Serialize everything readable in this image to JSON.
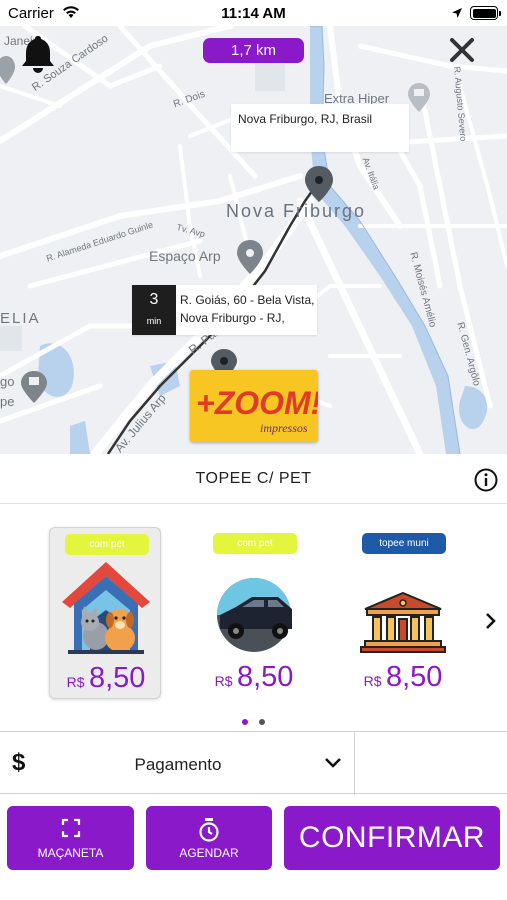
{
  "status_bar": {
    "carrier": "Carrier",
    "time": "11:14 AM"
  },
  "map": {
    "distance": "1,7 km",
    "destination_address": "Nova Friburgo, RJ, Brasil",
    "origin_eta_value": "3",
    "origin_eta_unit": "min",
    "origin_address_line1": "R. Goiás, 60 - Bela Vista,",
    "origin_address_line2": "Nova Friburgo - RJ,",
    "labels": {
      "city": "Nova Friburgo",
      "poi_arp": "Espaço Arp",
      "poi_extra": "Extra Hiper",
      "street_souza": "R. Souza Cardoso",
      "street_dois": "R. Dois",
      "street_alameda": "R. Alameda Eduardo Guinle",
      "street_avp": "Tv. Avp",
      "street_pastor": "R. Pastor",
      "street_julius": "Av. Julius Arp",
      "street_italia": "Av. Itália",
      "street_augusto": "R. Augusto Severo",
      "street_moises": "R. Moisés Amélio",
      "street_gen": "R. Gen. Argôlo",
      "edge_janeiro": "Janeiro",
      "edge_lia": "ELIA",
      "edge_go": "go",
      "edge_pe": "pe"
    },
    "colors": {
      "accent": "#8a19c9",
      "water": "#b8d1ec",
      "road": "#ffffff",
      "route": "#333333"
    }
  },
  "service": {
    "title": "TOPEE C/ PET"
  },
  "options": [
    {
      "tag": "com pet",
      "tag_color": "yellow",
      "currency": "R$",
      "price": "8,50",
      "icon": "pets-house-icon",
      "selected": true
    },
    {
      "tag": "com pet",
      "tag_color": "yellow",
      "currency": "R$",
      "price": "8,50",
      "icon": "car-icon",
      "selected": false
    },
    {
      "tag": "topee muni",
      "tag_color": "blue",
      "currency": "R$",
      "price": "8,50",
      "icon": "municipal-building-icon",
      "selected": false
    }
  ],
  "payment": {
    "symbol": "$",
    "label": "Pagamento"
  },
  "actions": {
    "handle_label": "MAÇANETA",
    "schedule_label": "AGENDAR",
    "confirm_label": "CONFIRMAR"
  },
  "logo_text": {
    "main": "+ZOOM!",
    "sub": "impressos"
  }
}
